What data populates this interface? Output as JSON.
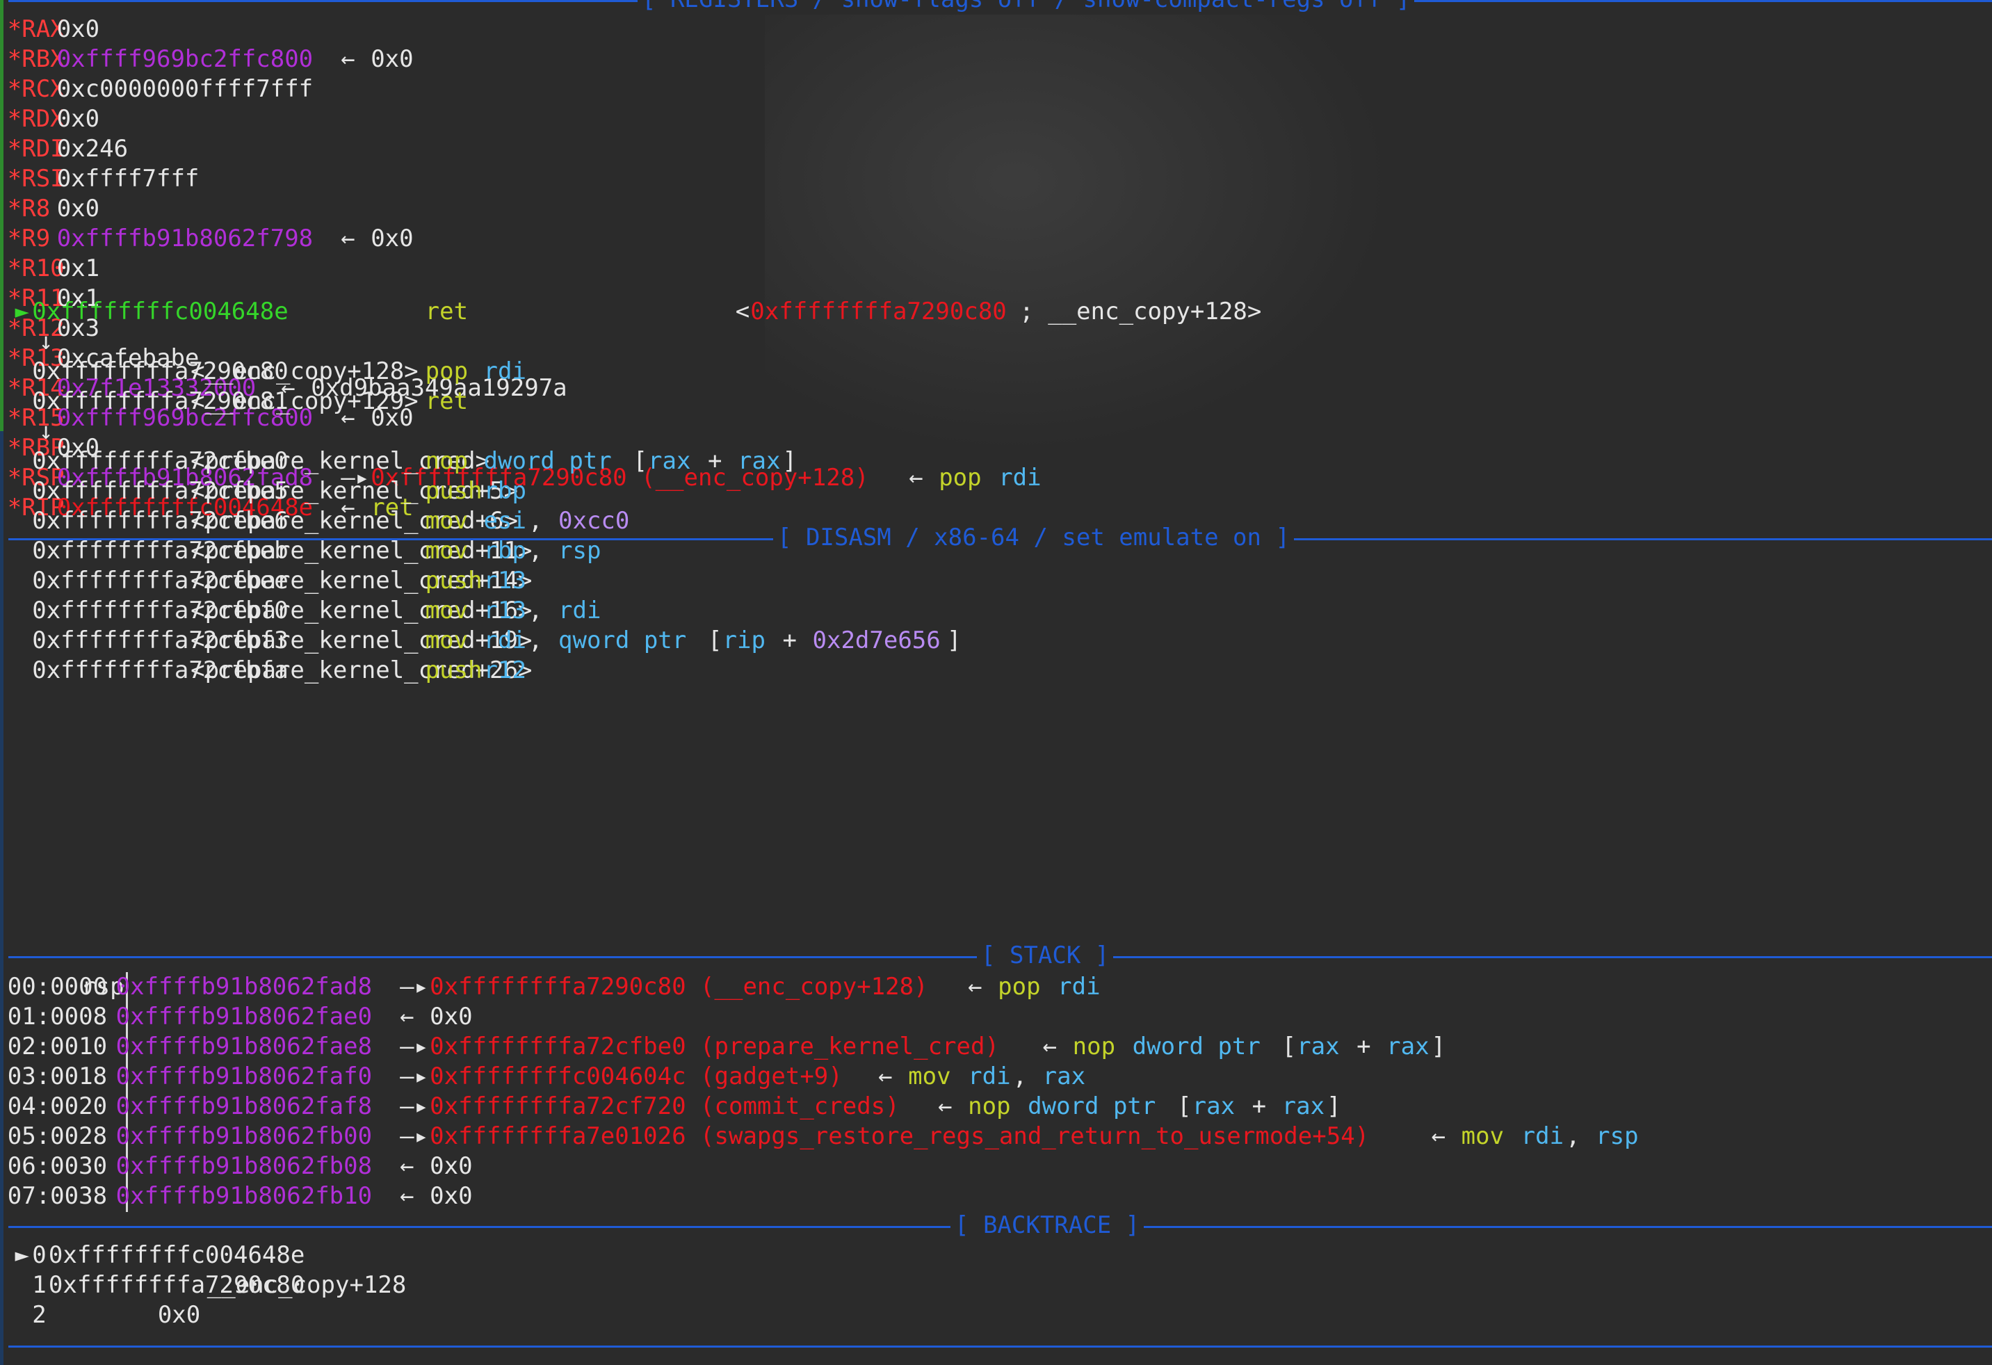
{
  "headers": {
    "registers": "[ REGISTERS / show-flags off / show-compact-regs off ]",
    "disasm": "[ DISASM / x86-64 / set emulate on ]",
    "stack": "[ STACK ]",
    "backtrace": "[ BACKTRACE ]"
  },
  "arrows": {
    "points_to": "←",
    "derefs": "—▸",
    "down": "↓",
    "current": "►"
  },
  "registers": [
    {
      "name": "*RAX",
      "value": "0x0"
    },
    {
      "name": "*RBX",
      "value": "0xffff969bc2ffc800",
      "deref": "0x0"
    },
    {
      "name": "*RCX",
      "value": "0xc0000000ffff7fff"
    },
    {
      "name": "*RDX",
      "value": "0x0"
    },
    {
      "name": "*RDI",
      "value": "0x246"
    },
    {
      "name": "*RSI",
      "value": "0xffff7fff"
    },
    {
      "name": "*R8",
      "value": "0x0"
    },
    {
      "name": "*R9",
      "value": "0xffffb91b8062f798",
      "deref": "0x0"
    },
    {
      "name": "*R10",
      "value": "0x1"
    },
    {
      "name": "*R11",
      "value": "0x1"
    },
    {
      "name": "*R12",
      "value": "0x3"
    },
    {
      "name": "*R13",
      "value": "0xcafebabe"
    },
    {
      "name": "*R14",
      "value": "0x7f1e13332000",
      "deref": "0xd9baa349aa19297a"
    },
    {
      "name": "*R15",
      "value": "0xffff969bc2ffc800",
      "deref": "0x0"
    },
    {
      "name": "*RBP",
      "value": "0x0"
    },
    {
      "name": "*RSP",
      "value": "0xffffb91b8062fad8",
      "target": "0xffffffffa7290c80 (__enc_copy+128)",
      "insn": "pop",
      "ops": "rdi"
    },
    {
      "name": "*RIP",
      "value": "0xffffffffc004648e",
      "insn": "ret"
    }
  ],
  "disasm": {
    "current": {
      "addr": "0xffffffffc004648e",
      "insn": "ret",
      "note_addr": "0xffffffffa7290c80",
      "note_sym": "; __enc_copy+128>"
    },
    "group1": [
      {
        "addr": "0xffffffffa7290c80",
        "sym": "<__enc_copy+128>",
        "insn": "pop",
        "ops": "rdi"
      },
      {
        "addr": "0xffffffffa7290c81",
        "sym": "<__enc_copy+129>",
        "insn": "ret",
        "ops": ""
      }
    ],
    "group2": [
      {
        "addr": "0xffffffffa72cfbe0",
        "sym": "<prepare_kernel_cred>",
        "insn": "nop",
        "ops": "dword ptr [rax + rax]"
      },
      {
        "addr": "0xffffffffa72cfbe5",
        "sym": "<prepare_kernel_cred+5>",
        "insn": "push",
        "ops": "rbp"
      },
      {
        "addr": "0xffffffffa72cfbe6",
        "sym": "<prepare_kernel_cred+6>",
        "insn": "mov",
        "ops": "esi, 0xcc0"
      },
      {
        "addr": "0xffffffffa72cfbeb",
        "sym": "<prepare_kernel_cred+11>",
        "insn": "mov",
        "ops": "rbp, rsp"
      },
      {
        "addr": "0xffffffffa72cfbee",
        "sym": "<prepare_kernel_cred+14>",
        "insn": "push",
        "ops": "r13"
      },
      {
        "addr": "0xffffffffa72cfbf0",
        "sym": "<prepare_kernel_cred+16>",
        "insn": "mov",
        "ops": "r13, rdi"
      },
      {
        "addr": "0xffffffffa72cfbf3",
        "sym": "<prepare_kernel_cred+19>",
        "insn": "mov",
        "ops": "rdi, qword ptr [rip + 0x2d7e656]"
      },
      {
        "addr": "0xffffffffa72cfbfa",
        "sym": "<prepare_kernel_cred+26>",
        "insn": "push",
        "ops": "r12"
      }
    ]
  },
  "stack": [
    {
      "idx": "00:0000",
      "label": "rsp",
      "addr": "0xffffb91b8062fad8",
      "target": "0xffffffffa7290c80 (__enc_copy+128)",
      "insn": "pop",
      "ops": "rdi"
    },
    {
      "idx": "01:0008",
      "label": "",
      "addr": "0xffffb91b8062fae0",
      "value": "0x0"
    },
    {
      "idx": "02:0010",
      "label": "",
      "addr": "0xffffb91b8062fae8",
      "target": "0xffffffffa72cfbe0 (prepare_kernel_cred)",
      "insn": "nop",
      "ops": "dword ptr [rax + rax]"
    },
    {
      "idx": "03:0018",
      "label": "",
      "addr": "0xffffb91b8062faf0",
      "target": "0xffffffffc004604c (gadget+9)",
      "insn": "mov",
      "ops": "rdi, rax"
    },
    {
      "idx": "04:0020",
      "label": "",
      "addr": "0xffffb91b8062faf8",
      "target": "0xffffffffa72cf720 (commit_creds)",
      "insn": "nop",
      "ops": "dword ptr [rax + rax]"
    },
    {
      "idx": "05:0028",
      "label": "",
      "addr": "0xffffb91b8062fb00",
      "target": "0xffffffffa7e01026 (swapgs_restore_regs_and_return_to_usermode+54)",
      "insn": "mov",
      "ops": "rdi, rsp"
    },
    {
      "idx": "06:0030",
      "label": "",
      "addr": "0xffffb91b8062fb08",
      "value": "0x0"
    },
    {
      "idx": "07:0038",
      "label": "",
      "addr": "0xffffb91b8062fb10",
      "value": "0x0"
    }
  ],
  "backtrace": [
    {
      "frame": "0",
      "addr": "0xffffffffc004648e",
      "sym": ""
    },
    {
      "frame": "1",
      "addr": "0xffffffffa7290c80",
      "sym": "__enc_copy+128"
    },
    {
      "frame": "2",
      "addr": "0x0",
      "sym": ""
    }
  ]
}
